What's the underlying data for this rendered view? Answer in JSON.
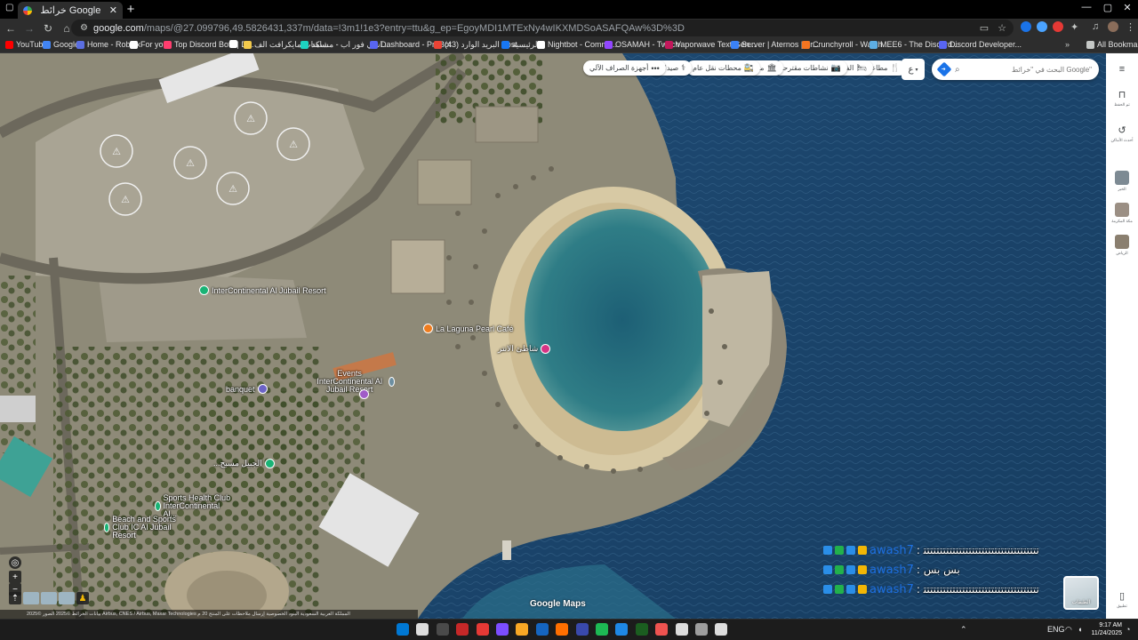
{
  "browser": {
    "tab_title": "خرائط Google",
    "url_domain": "google.com",
    "url_rest": "/maps/@27.099796,49.5826431,337m/data=!3m1!1e3?entry=ttu&g_ep=EgoyMDI1MTExNy4wIKXMDSoASAFQAw%3D%3D",
    "all_bookmarks": "All Bookmarks"
  },
  "bookmarks": [
    {
      "label": "YouTube",
      "color": "#ff0000"
    },
    {
      "label": "Google",
      "color": "#4285f4"
    },
    {
      "label": "Home - Roblox",
      "color": "#5b6ee1"
    },
    {
      "label": "For you",
      "color": "#ffffff"
    },
    {
      "label": "Top Discord Bots | D...",
      "color": "#ff3d6e"
    },
    {
      "label": "",
      "color": "#ffffff"
    },
    {
      "label": "سكنات مايكرافت الف...",
      "color": "#f2c94c"
    },
    {
      "label": "انمي فور اب - مشاهد...",
      "color": "#1dd3c0"
    },
    {
      "label": "Dashboard - ProBot",
      "color": "#5865f2"
    },
    {
      "label": "(43) البريد الوارد - ost...",
      "color": "#ea4335"
    },
    {
      "label": "الرئيسية",
      "color": "#1877f2"
    },
    {
      "label": "Nightbot - Comma...",
      "color": "#ffffff"
    },
    {
      "label": "OSAMAH - Twitch",
      "color": "#9146ff"
    },
    {
      "label": "Vaporwave Text Gen...",
      "color": "#c2185b"
    },
    {
      "label": "Server | Aternos | Fr...",
      "color": "#3b82f6"
    },
    {
      "label": "Crunchyroll - Watch...",
      "color": "#f47521"
    },
    {
      "label": "MEE6 - The Discord...",
      "color": "#5dade2"
    },
    {
      "label": "Discord Developer...",
      "color": "#5865f2"
    }
  ],
  "map": {
    "search_placeholder": "البحث في \"خرائط Google\"",
    "lang_button": "ع",
    "chips": [
      {
        "label": "مطاعم",
        "icon": "🍴"
      },
      {
        "label": "الفنادق",
        "icon": "🛏"
      },
      {
        "label": "نشاطات مقترحة",
        "icon": "📷"
      },
      {
        "label": "متاحف",
        "icon": "🏛"
      },
      {
        "label": "محطات نقل عام",
        "icon": "🚉"
      },
      {
        "label": "صيدليات",
        "icon": "⚕"
      },
      {
        "label": "أجهزة الصراف الآلي",
        "icon": "•••"
      }
    ],
    "places": [
      {
        "name": "InterContinental Al Jubail Resort",
        "color": "#19b375"
      },
      {
        "name": "La Laguna Pearl Café",
        "color": "#ef7c1e"
      },
      {
        "name": "شاطئ الانتر",
        "color": "#d63384"
      },
      {
        "name": "Events InterContinental Al Jubail Resort",
        "color": "#6c8ea0"
      },
      {
        "name": "banquet",
        "color": "#6c63c6"
      },
      {
        "name": "",
        "color": "#a05cc8"
      },
      {
        "name": "...الجبيل مسبح",
        "color": "#19b375"
      },
      {
        "name": "Sports Health Club InterContinental Al...",
        "color": "#19b375"
      },
      {
        "name": "Beach and Sports Club IC Al Jubail Resort",
        "color": "#19b375"
      }
    ],
    "logo": "Google Maps",
    "attribution": "بيانات الخرائط ©2025 الصور ©2025 Airbus, CNES / Airbus, Maxar Technologies  المملكة العربية السعودية  البنود  الخصوصية  إرسال ملاحظات على المنتج  20 م",
    "layers_label": "الطبقات"
  },
  "chat": [
    {
      "user": "awash7",
      "message": ": ﺗﺘﺘﺘﺘﺘﺘﺘﺘﺘﺘﺘﺘﺘﺘﺘﺘﺘﺘﺘﺘﺘﺘﺘﺘﺘﺘﺘﺘﺘﺘﺘﺘﺘﺘﺘ"
    },
    {
      "user": "awash7",
      "message": ": بس بس"
    },
    {
      "user": "awash7",
      "message": ": ﺗﺘﺘﺘﺘﺘﺘﺘﺘﺘﺘﺘﺘﺘﺘﺘﺘﺘﺘﺘﺘﺘﺘﺘﺘﺘﺘﺘﺘﺘﺘﺘﺘﺘﺘﺘ"
    }
  ],
  "side_panel": [
    {
      "label": "تم الحفظ",
      "icon": "bookmark-icon"
    },
    {
      "label": "أحدث الأماكن",
      "icon": "history-icon"
    },
    {
      "label": "الخبر",
      "icon": "thumb"
    },
    {
      "label": "مكة المكرمة",
      "icon": "thumb"
    },
    {
      "label": "الرياض",
      "icon": "thumb"
    }
  ],
  "side_panel_bottom": "تطبيق",
  "taskbar": {
    "lang": "ENG",
    "time": "9:17 AM",
    "date": "11/24/2025"
  }
}
